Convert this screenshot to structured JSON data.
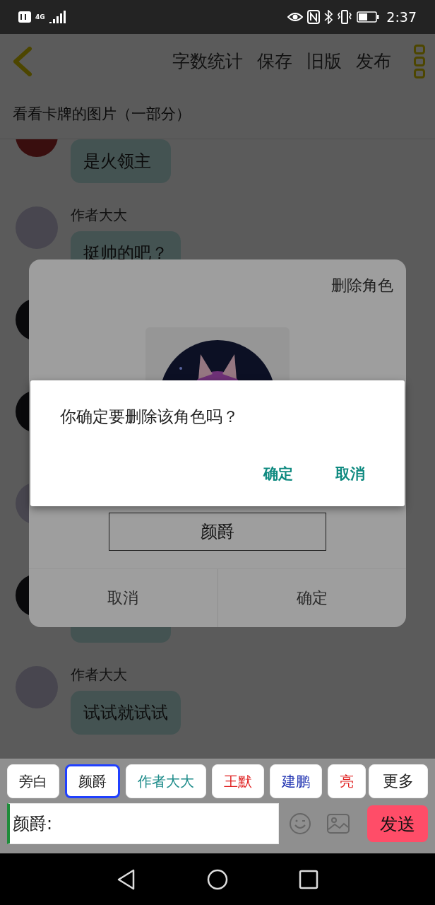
{
  "status_bar": {
    "network": "4G",
    "time": "2:37"
  },
  "app_bar": {
    "actions": [
      "字数统计",
      "保存",
      "旧版",
      "发布"
    ]
  },
  "title": "看看卡牌的图片（一部分）",
  "messages": [
    {
      "kind": "red",
      "bubble": true,
      "text": "是火领主"
    },
    {
      "kind": "light",
      "bubble": true,
      "name": "作者大大",
      "text": "挺帅的吧？"
    },
    {
      "kind": "dark",
      "bubble": false
    },
    {
      "kind": "dark",
      "bubble": false
    },
    {
      "kind": "light",
      "bubble": false
    },
    {
      "kind": "dark",
      "bubble": true
    },
    {
      "kind": "light",
      "bubble": true,
      "name": "作者大大",
      "text": "试试就试试"
    }
  ],
  "chips": [
    {
      "label": "旁白",
      "color": "#222222",
      "selected": false
    },
    {
      "label": "颜爵",
      "color": "#222222",
      "selected": true
    },
    {
      "label": "作者大大",
      "color": "#1e8c8a",
      "selected": false
    },
    {
      "label": "王默",
      "color": "#e02020",
      "selected": false
    },
    {
      "label": "建鹏",
      "color": "#1c2fb0",
      "selected": false
    },
    {
      "label": "亮",
      "color": "#e02020",
      "selected": false
    }
  ],
  "more_button": "更多",
  "input": {
    "value": "颜爵:"
  },
  "send_button": "发送",
  "role_dialog": {
    "title": "删除角色",
    "name_value": "颜爵",
    "buttons": [
      "取消",
      "确定"
    ]
  },
  "confirm_dialog": {
    "message": "你确定要删除该角色吗？",
    "buttons": [
      "确定",
      "取消"
    ]
  }
}
